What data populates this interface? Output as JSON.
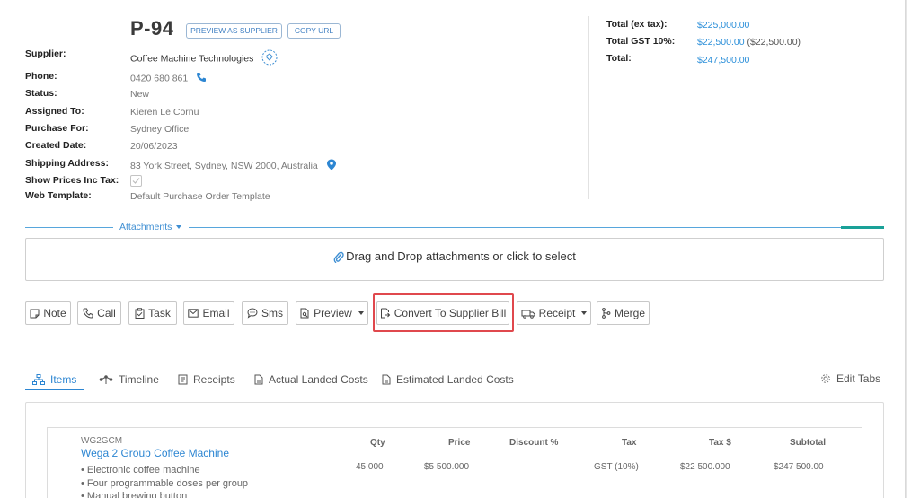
{
  "header": {
    "po_number": "P-94",
    "preview_as_supplier_label": "PREVIEW AS SUPPLIER",
    "copy_url_label": "COPY URL"
  },
  "fields": [
    {
      "label": "Supplier:",
      "value": "Coffee Machine Technologies"
    },
    {
      "label": "Phone:",
      "value": "0420 680 861"
    },
    {
      "label": "Status:",
      "value": "New"
    },
    {
      "label": "Assigned To:",
      "value": "Kieren Le Cornu"
    },
    {
      "label": "Purchase For:",
      "value": "Sydney Office"
    },
    {
      "label": "Created Date:",
      "value": "20/06/2023"
    },
    {
      "label": "Shipping Address:",
      "value": "83 York Street, Sydney, NSW 2000, Australia"
    },
    {
      "label": "Show Prices Inc Tax:",
      "value": ""
    },
    {
      "label": "Web Template:",
      "value": "Default Purchase Order Template"
    }
  ],
  "totals": {
    "ex_tax_label": "Total (ex tax):",
    "ex_tax_value": "$225,000.00",
    "gst_label": "Total GST 10%:",
    "gst_value": "$22,500.00",
    "gst_secondary": "($22,500.00)",
    "total_label": "Total:",
    "total_value": "$247,500.00"
  },
  "attachments": {
    "label": "Attachments",
    "dropzone_text": "Drag and Drop attachments or click to select"
  },
  "actions": {
    "note": "Note",
    "call": "Call",
    "task": "Task",
    "email": "Email",
    "sms": "Sms",
    "preview": "Preview",
    "convert": "Convert To Supplier Bill",
    "receipt": "Receipt",
    "merge": "Merge"
  },
  "tabs": {
    "items": "Items",
    "timeline": "Timeline",
    "receipts": "Receipts",
    "actual_landed_costs": "Actual Landed Costs",
    "estimated_landed_costs": "Estimated Landed Costs",
    "edit_tabs": "Edit Tabs"
  },
  "items_table": {
    "columns": {
      "qty": "Qty",
      "price": "Price",
      "discount": "Discount %",
      "tax": "Tax",
      "tax_amount": "Tax $",
      "subtotal": "Subtotal"
    },
    "rows": [
      {
        "code": "WG2GCM",
        "name": "Wega 2 Group Coffee Machine",
        "bullets": [
          "• Electronic coffee machine",
          "• Four programmable doses per group",
          "• Manual brewing button"
        ],
        "qty": "45.000",
        "price": "$5 500.000",
        "discount": "",
        "tax": "GST (10%)",
        "tax_amount": "$22 500.000",
        "subtotal": "$247 500.00"
      }
    ]
  },
  "colors": {
    "accent_blue": "#2d86d2",
    "highlight_red": "#e0484d",
    "attachment_accent": "#1aa198"
  },
  "icons": {
    "phone": "phone-icon",
    "supplier_tag": "tag-icon",
    "address": "map-pin-icon",
    "checkbox": "checkbox-icon"
  }
}
